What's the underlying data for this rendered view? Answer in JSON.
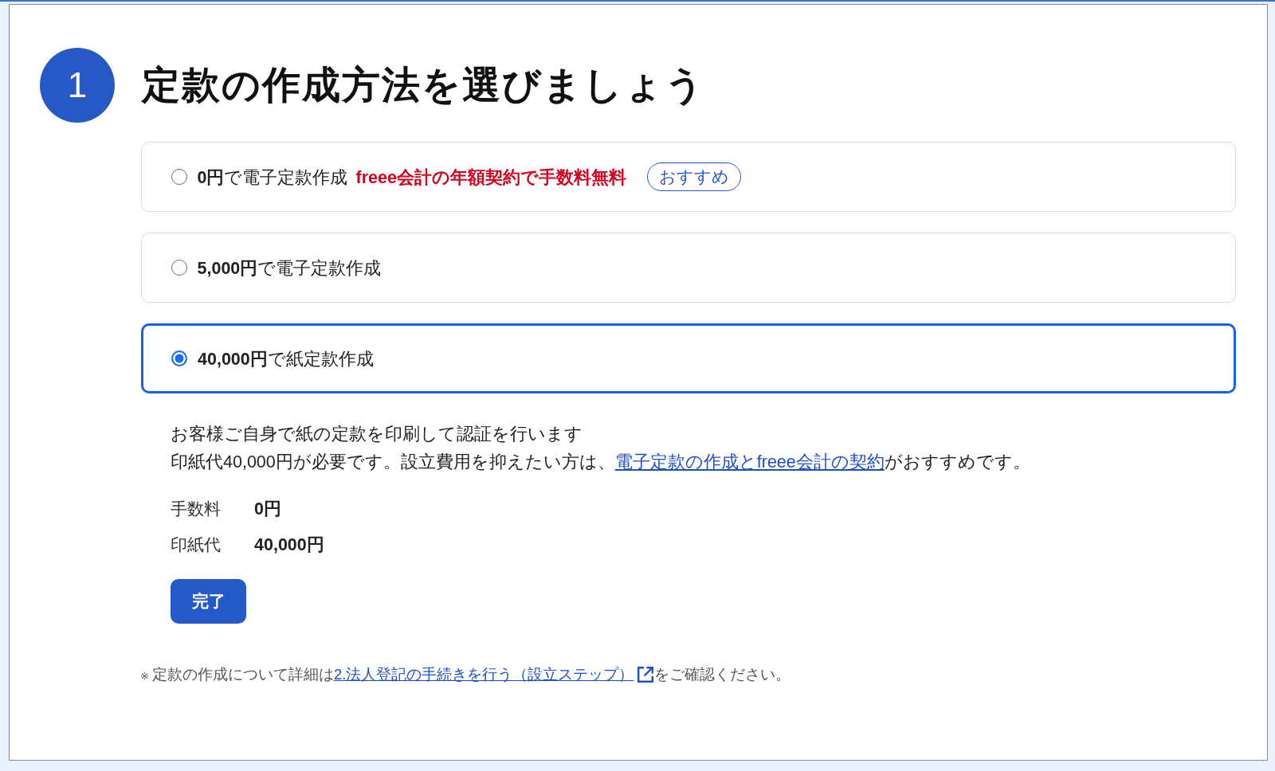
{
  "step": {
    "number": "1",
    "title": "定款の作成方法を選びましょう"
  },
  "options": [
    {
      "label": "**0円**で電子定款作成",
      "promo": "freee会計の年額契約で手数料無料",
      "badge": "おすすめ",
      "selected": false
    },
    {
      "label": "**5,000円**で電子定款作成",
      "selected": false
    },
    {
      "label": "**40,000円**で紙定款作成",
      "selected": true
    }
  ],
  "details": {
    "description": [
      {
        "text": "お客様ご自身で紙の定款を印刷して認証を行います"
      },
      {
        "text": "印紙代40,000円が必要です。設立費用を抑えたい方は、",
        "link": "電子定款の作成とfreee会計の契約",
        "after": "がおすすめです。"
      }
    ],
    "fees": [
      {
        "label": "手数料",
        "value": "0円"
      },
      {
        "label": "印紙代",
        "value": "40,000円"
      }
    ],
    "button": "完了"
  },
  "footnote": {
    "mark": "※",
    "text": "定款の作成について詳細は",
    "link": "2.法人登記の手続きを行う（設立ステップ）",
    "after": "をご確認ください。"
  }
}
